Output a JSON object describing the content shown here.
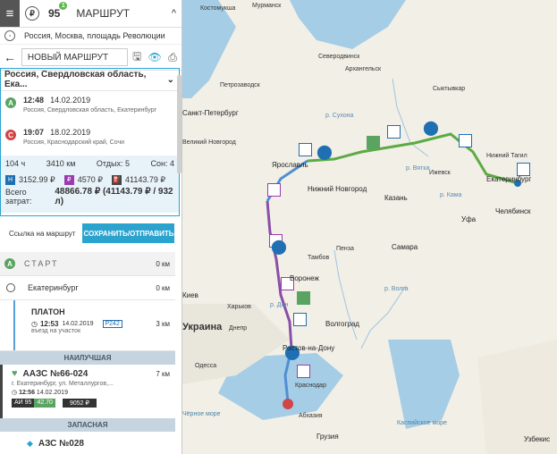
{
  "header": {
    "fuel_number": "95",
    "fuel_badge": "1",
    "title": "МАРШРУТ",
    "collapse_glyph": "^"
  },
  "address": {
    "text": "Россия, Москва, площадь Революции"
  },
  "route_toolbar": {
    "name": "НОВЫЙ МАРШРУТ"
  },
  "summary": {
    "region": "Россия, Свердловская область, Ека...",
    "start": {
      "marker": "A",
      "time": "12:48",
      "date": "14.02.2019",
      "place": "Россия, Свердловская область, Екатеринбург"
    },
    "end": {
      "marker": "C",
      "time": "19:07",
      "date": "18.02.2019",
      "place": "Россия, Краснодарский край, Сочи"
    },
    "stats": {
      "hours": "104 ч",
      "distance": "3410 км",
      "rest": "Отдых: 5",
      "sleep": "Сон: 4",
      "cost1": "3152.99 ₽",
      "cost2": "4570 ₽",
      "cost3": "41143.79 ₽",
      "total_label": "Всего затрат:",
      "total_value": "48866.78 ₽ (41143.79 ₽ / 932 л)"
    }
  },
  "save": {
    "link": "Ссылка на маршрут",
    "button": "СОХРАНИТЬ/ОТПРАВИТЬ"
  },
  "list": {
    "start": {
      "marker": "A",
      "label": "СТАРТ",
      "km": "0 км"
    },
    "city": {
      "name": "Екатеринбург",
      "km": "0 км"
    },
    "platon": {
      "name": "ПЛАТОН",
      "time": "12:53",
      "date": "14.02.2019",
      "note": "въезд на участок",
      "code": "P242",
      "km": "3 км"
    },
    "best": "НАИЛУЧШАЯ",
    "station1": {
      "name": "ААЗС №66-024",
      "address": "г. Екатеринбург, ул. Металлургов,...",
      "time": "12:56",
      "date": "14.02.2019",
      "fuel": "АИ 95",
      "price": "42.70",
      "sum": "9052 ₽",
      "km": "7 км"
    },
    "reserve": "ЗАПАСНАЯ",
    "station2": {
      "name": "АЗС №028"
    }
  },
  "map": {
    "labels": [
      "Костомукша",
      "Мурманск",
      "Северодвинск",
      "Архангельск",
      "Сыктывкар",
      "Петрозаводск",
      "Санкт-Петербург",
      "Великий Новгород",
      "Ярославль",
      "Нижний Новгород",
      "Казань",
      "Ижевск",
      "Нижний Тагил",
      "Екатеринбург",
      "Челябинск",
      "Уфа",
      "Самара",
      "Пенза",
      "Тамбов",
      "Воронеж",
      "Харьков",
      "Киев",
      "Украина",
      "Днепр",
      "Волгоград",
      "Ростов-на-Дону",
      "Одесса",
      "Краснодар",
      "Абхазия",
      "Грузия",
      "Чёрное море",
      "Каспийское море",
      "Узбекис"
    ],
    "rivers": [
      "р. Сухона",
      "р. Вятка",
      "р. Кама",
      "р. Дон",
      "р. Волга"
    ]
  },
  "colors": {
    "route_green": "#5daa45",
    "route_blue": "#4f8fd2",
    "route_purple": "#8a4fa8",
    "accent": "#2ba3cf",
    "poi_blue": "#1f6fb3"
  }
}
